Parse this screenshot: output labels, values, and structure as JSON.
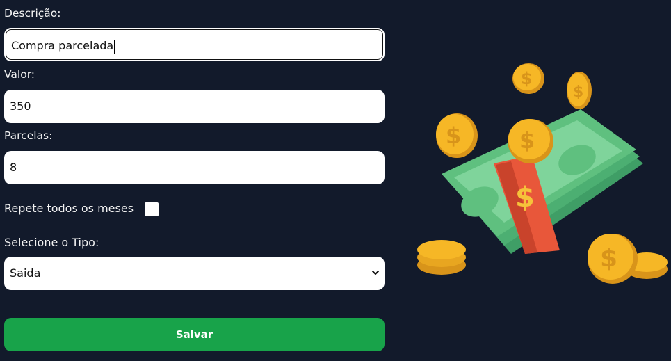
{
  "form": {
    "descricao": {
      "label": "Descrição:",
      "value": "Compra parcelada"
    },
    "valor": {
      "label": "Valor:",
      "value": "350"
    },
    "parcelas": {
      "label": "Parcelas:",
      "value": "8"
    },
    "repete": {
      "label": "Repete todos os meses",
      "checked": false
    },
    "tipo": {
      "label": "Selecione o Tipo:",
      "selected": "Saida"
    },
    "save_label": "Salvar"
  },
  "illustration": {
    "icon": "money-stack-with-coins-icon",
    "colors": {
      "bill": "#5fc07f",
      "band": "#e8573a",
      "coin": "#f6b726"
    }
  },
  "colors": {
    "background": "#121a2b",
    "button": "#18a34a"
  }
}
